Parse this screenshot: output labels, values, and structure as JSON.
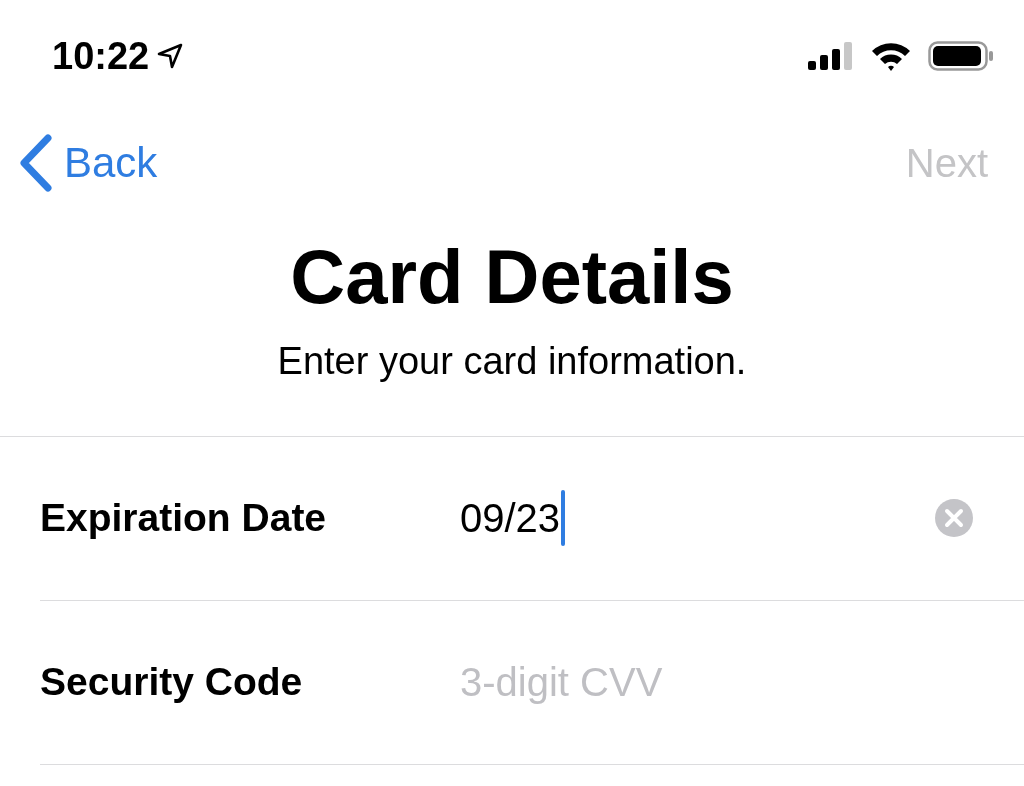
{
  "status_bar": {
    "time": "10:22"
  },
  "nav": {
    "back": "Back",
    "next": {
      "label": "Next",
      "disabled": true
    }
  },
  "title": "Card Details",
  "subtitle": "Enter your card information.",
  "fields": [
    {
      "label": "Expiration Date",
      "value": "09/23",
      "focused": true
    },
    {
      "label": "Security Code",
      "placeholder": "3-digit CVV",
      "focused": false
    }
  ]
}
